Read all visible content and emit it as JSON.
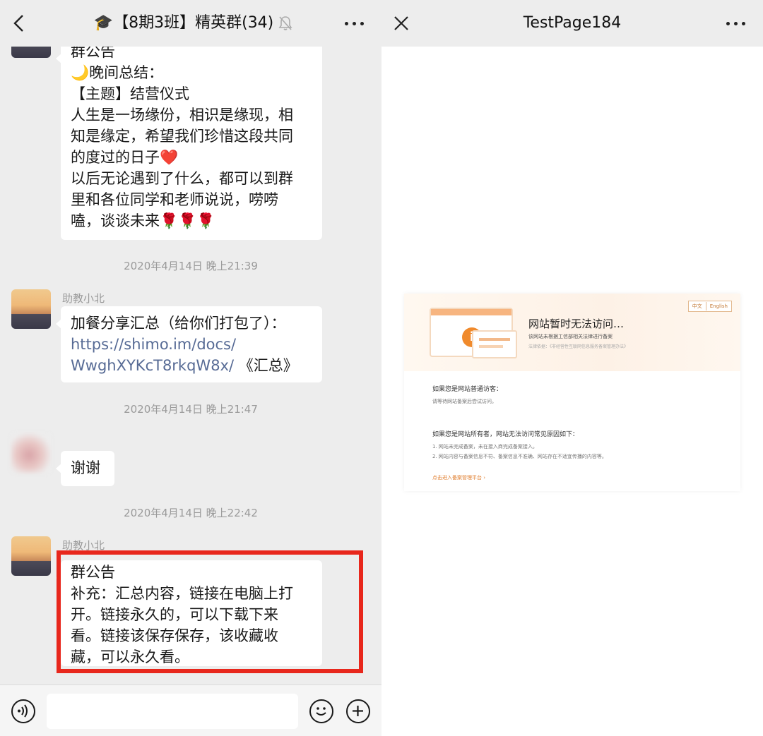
{
  "left": {
    "header": {
      "title": "🎓【8期3班】精英群(34)",
      "back_icon": "chevron-left-icon",
      "mute_icon": "bell-off-icon",
      "more_icon": "ellipsis-icon"
    },
    "messages": [
      {
        "sender": "",
        "lines": [
          "群公告",
          "🌙晚间总结：",
          "【主题】结营仪式",
          "人生是一场缘份，相识是缘现，相",
          "知是缘定，希望我们珍惜这段共同",
          "的度过的日子❤️",
          "以后无论遇到了什么，都可以到群",
          "里和各位同学和老师说说，唠唠",
          "嗑，谈谈未来🌹🌹🌹"
        ]
      },
      {
        "timestamp": "2020年4月14日 晚上21:39",
        "sender": "助教小北",
        "text": "加餐分享汇总（给你们打包了）：",
        "link_line1": "https://shimo.im/docs/",
        "link_line2": "WwghXYKcT8rkqW8x/",
        "after_link": " 《汇总》"
      },
      {
        "timestamp": "2020年4月14日 晚上21:47",
        "sender": "",
        "text": "谢谢"
      },
      {
        "timestamp": "2020年4月14日 晚上22:42",
        "sender": "助教小北",
        "lines": [
          "群公告",
          "补充：汇总内容，链接在电脑上打",
          "开。链接永久的，可以下载下来",
          "看。链接该保存保存，该收藏收",
          "藏，可以永久看。"
        ]
      }
    ],
    "bottom": {
      "voice_icon": "voice-icon",
      "emoji_icon": "emoji-icon",
      "plus_icon": "plus-icon"
    }
  },
  "right": {
    "header": {
      "title": "TestPage184",
      "close_icon": "close-icon",
      "more_icon": "ellipsis-icon"
    },
    "error": {
      "lang_zh": "中文",
      "lang_en": "English",
      "title": "网站暂时无法访问…",
      "subtitle": "该网站未根据工信部相关法律进行备案",
      "note": "法律依据：《非经营性互联网信息服务备案管理办法》",
      "visitor_heading": "如果您是网站普通访客：",
      "visitor_text": "请等待网站备案后尝试访问。",
      "owner_heading": "如果您是网站所有者，网站无法访问常见原因如下：",
      "reason1": "1. 网站未完成备案，未在接入商完成备案接入。",
      "reason2": "2. 网站内容与备案信息不符、备案信息不准确、网站存在不适宜传播的内容等。",
      "link": "点击进入备案管理平台 ›"
    }
  }
}
